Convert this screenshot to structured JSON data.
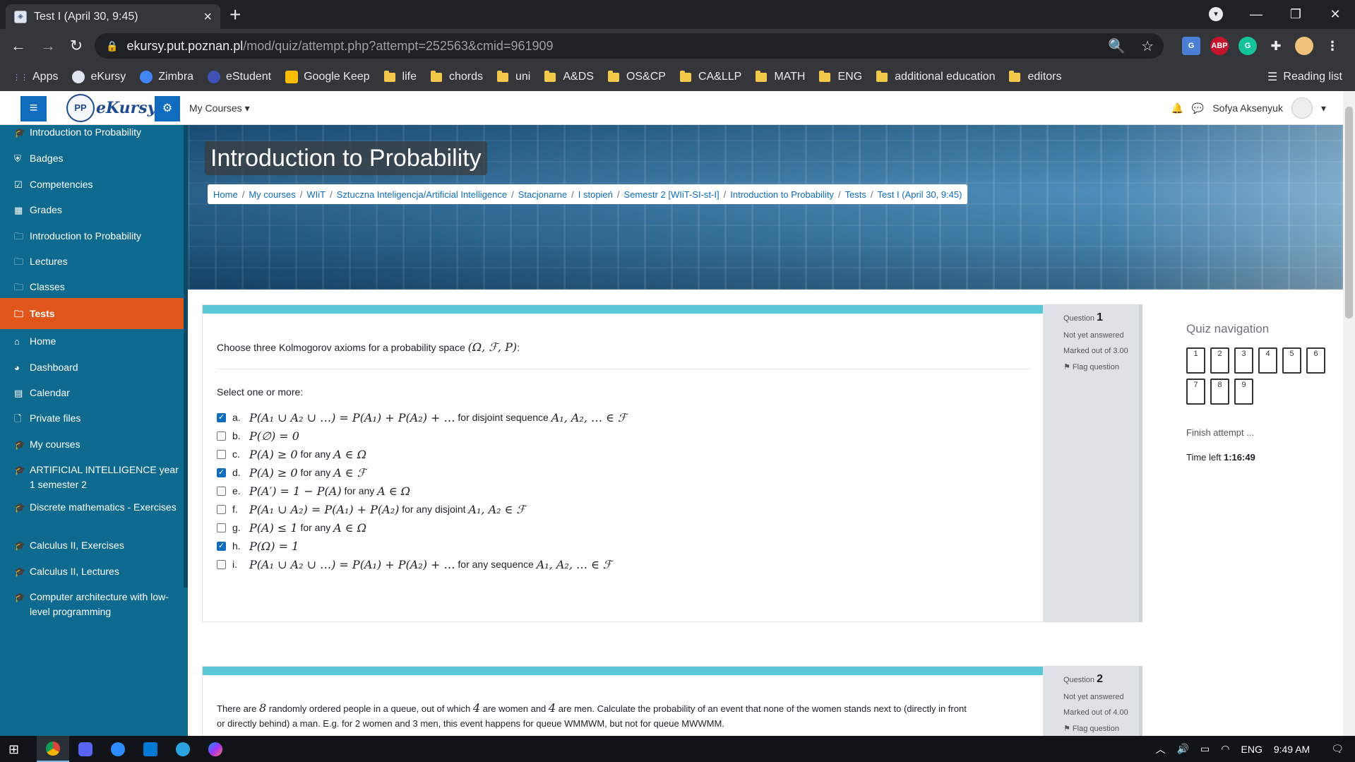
{
  "browser": {
    "tab_title": "Test I (April 30, 9:45)",
    "url_host": "ekursy.put.poznan.pl",
    "url_path": "/mod/quiz/attempt.php?attempt=252563&cmid=961909",
    "bookmarks": [
      "Apps",
      "eKursy",
      "Zimbra",
      "eStudent",
      "Google Keep",
      "life",
      "chords",
      "uni",
      "A&DS",
      "OS&CP",
      "CA&LLP",
      "MATH",
      "ENG",
      "additional education",
      "editors"
    ],
    "reading_list": "Reading list",
    "ext_abp": "ABP"
  },
  "header": {
    "logo_text": "eKursy",
    "my_courses": "My Courses ▾",
    "user_name": "Sofya Aksenyuk"
  },
  "sidebar": {
    "items": [
      {
        "icon": "graduation-cap-icon",
        "glyph": "🎓",
        "label": "Introduction to Probability"
      },
      {
        "icon": "shield-icon",
        "glyph": "⛨",
        "label": "Badges"
      },
      {
        "icon": "checkbox-icon",
        "glyph": "☑",
        "label": "Competencies"
      },
      {
        "icon": "table-icon",
        "glyph": "▦",
        "label": "Grades"
      },
      {
        "icon": "folder-icon",
        "glyph": "🗀",
        "label": "Introduction to Probability"
      },
      {
        "icon": "folder-icon",
        "glyph": "🗀",
        "label": "Lectures"
      },
      {
        "icon": "folder-icon",
        "glyph": "🗀",
        "label": "Classes"
      },
      {
        "icon": "folder-icon",
        "glyph": "🗀",
        "label": "Tests"
      },
      {
        "icon": "home-icon",
        "glyph": "⌂",
        "label": "Home"
      },
      {
        "icon": "dashboard-icon",
        "glyph": "◕",
        "label": "Dashboard"
      },
      {
        "icon": "calendar-icon",
        "glyph": "▤",
        "label": "Calendar"
      },
      {
        "icon": "file-icon",
        "glyph": "🗋",
        "label": "Private files"
      },
      {
        "icon": "graduation-cap-icon",
        "glyph": "🎓",
        "label": "My courses"
      },
      {
        "icon": "graduation-cap-icon",
        "glyph": "🎓",
        "label": "ARTIFICIAL INTELLIGENCE year 1 semester 2"
      },
      {
        "icon": "graduation-cap-icon",
        "glyph": "🎓",
        "label": "Discrete mathematics - Exercises"
      },
      {
        "icon": "graduation-cap-icon",
        "glyph": "🎓",
        "label": "Calculus II, Exercises"
      },
      {
        "icon": "graduation-cap-icon",
        "glyph": "🎓",
        "label": "Calculus II, Lectures"
      },
      {
        "icon": "graduation-cap-icon",
        "glyph": "🎓",
        "label": "Computer architecture with low-level programming"
      }
    ],
    "active_index": 7
  },
  "page": {
    "course_title": "Introduction to Probability",
    "breadcrumb": [
      "Home",
      "My courses",
      "WIiT",
      "Sztuczna Inteligencja/Artificial Intelligence",
      "Stacjonarne",
      "I stopień",
      "Semestr 2 [WIiT-SI-st-I]",
      "Introduction to Probability",
      "Tests",
      "Test I (April 30, 9:45)"
    ]
  },
  "question1": {
    "number_label": "Question",
    "number": "1",
    "status": "Not yet answered",
    "marked": "Marked out of 3.00",
    "flag": "Flag question",
    "text_pre": "Choose three Kolmogorov axioms for a probability space ",
    "text_math": "(Ω, ℱ, P)",
    "text_post": ":",
    "select_label": "Select one or more:",
    "options": [
      {
        "letter": "a.",
        "checked": true,
        "math": "P(A₁ ∪ A₂ ∪ …) = P(A₁) + P(A₂) + …",
        "text": " for disjoint sequence ",
        "math2": "A₁, A₂, … ∈ ℱ"
      },
      {
        "letter": "b.",
        "checked": false,
        "math": "P(∅) = 0",
        "text": "",
        "math2": ""
      },
      {
        "letter": "c.",
        "checked": false,
        "math": "P(A) ≥ 0",
        "text": " for any ",
        "math2": "A ∈ Ω"
      },
      {
        "letter": "d.",
        "checked": true,
        "math": "P(A) ≥ 0",
        "text": " for any ",
        "math2": "A ∈ ℱ"
      },
      {
        "letter": "e.",
        "checked": false,
        "math": "P(A′) = 1 − P(A)",
        "text": " for any ",
        "math2": "A ∈ Ω"
      },
      {
        "letter": "f.",
        "checked": false,
        "math": "P(A₁ ∪ A₂) = P(A₁) + P(A₂)",
        "text": " for any disjoint ",
        "math2": "A₁, A₂ ∈ ℱ"
      },
      {
        "letter": "g.",
        "checked": false,
        "math": "P(A) ≤ 1",
        "text": " for any ",
        "math2": "A ∈ Ω"
      },
      {
        "letter": "h.",
        "checked": true,
        "math": "P(Ω) = 1",
        "text": "",
        "math2": ""
      },
      {
        "letter": "i.",
        "checked": false,
        "math": "P(A₁ ∪ A₂ ∪ …) = P(A₁) + P(A₂) + …",
        "text": " for any sequence ",
        "math2": "A₁, A₂, … ∈ ℱ"
      }
    ]
  },
  "question2": {
    "number_label": "Question",
    "number": "2",
    "status": "Not yet answered",
    "marked": "Marked out of 4.00",
    "flag": "Flag question",
    "text_a": "There are ",
    "m1": "8",
    "text_b": " randomly ordered people in a queue, out of which ",
    "m2": "4",
    "text_c": " are women and ",
    "m3": "4",
    "text_d": " are men. Calculate the probability of an event that none of the women stands next to (directly in front",
    "line2": "or directly behind) a man. E.g. for 2 women and 3 men, this event happens for queue WMMWM, but not for queue MWWMM."
  },
  "quiz_nav": {
    "title": "Quiz navigation",
    "questions": [
      "1",
      "2",
      "3",
      "4",
      "5",
      "6",
      "7",
      "8",
      "9"
    ],
    "finish": "Finish attempt ...",
    "time_left_label": "Time left ",
    "time_left": "1:16:49"
  },
  "taskbar": {
    "lang": "ENG",
    "time": "9:49 AM"
  },
  "colors": {
    "sidebar": "#0e6a8f",
    "active": "#e0561b",
    "accent": "#5bc8d8",
    "primary": "#0f6cbf"
  }
}
